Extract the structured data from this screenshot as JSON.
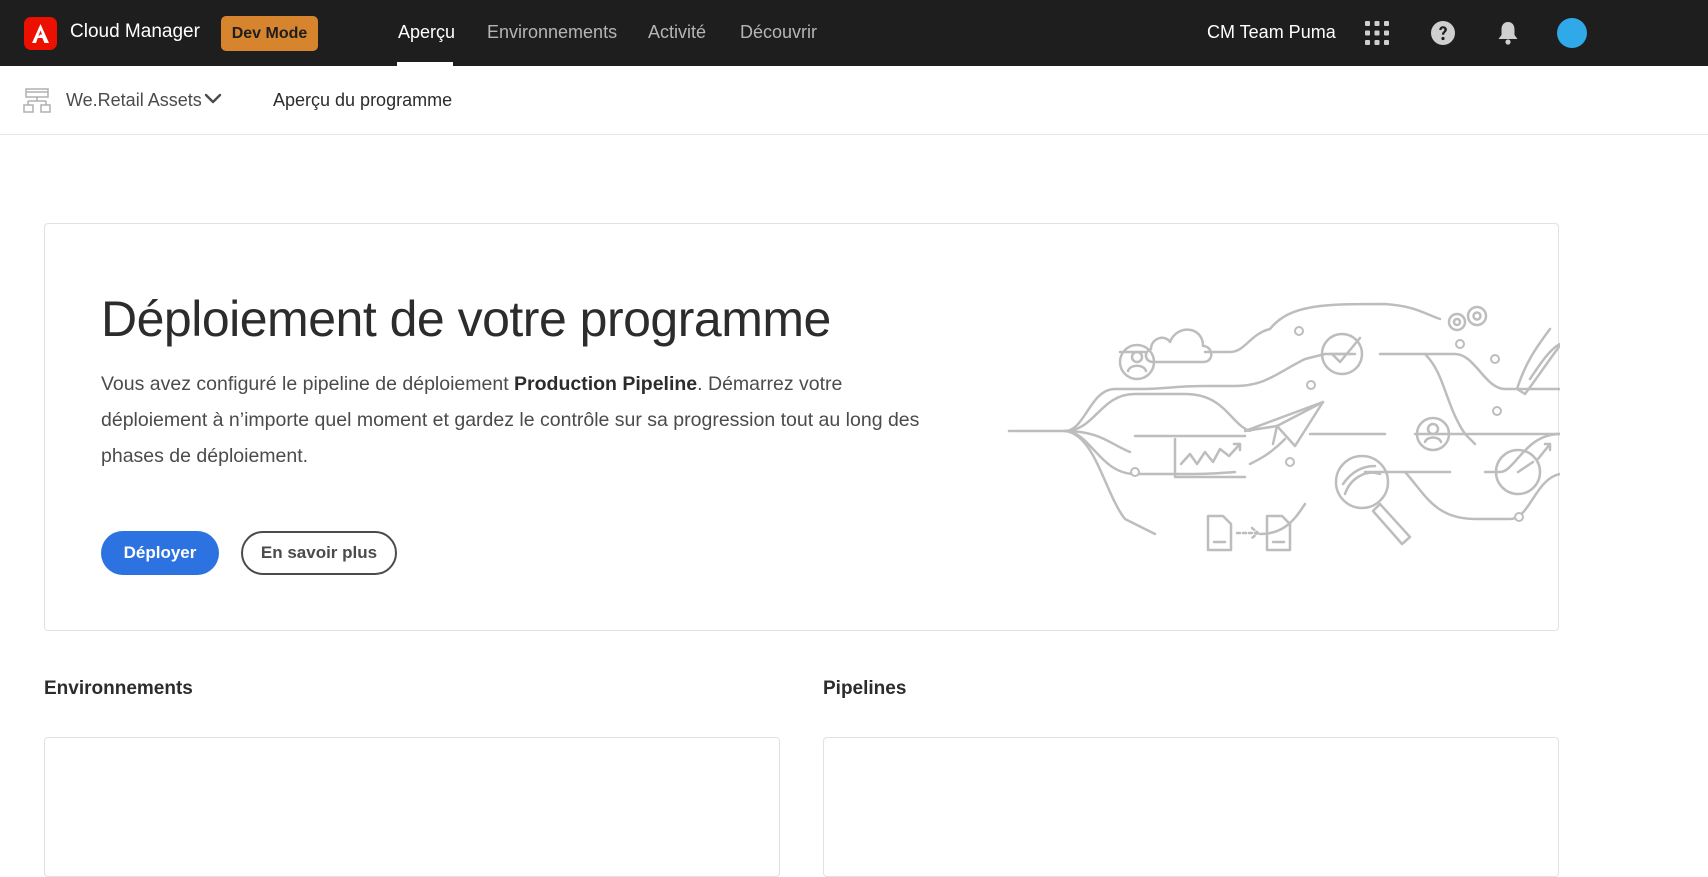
{
  "header": {
    "app_title": "Cloud Manager",
    "dev_mode_label": "Dev Mode",
    "tabs": [
      {
        "label": "Aperçu",
        "active": true
      },
      {
        "label": "Environnements",
        "active": false
      },
      {
        "label": "Activité",
        "active": false
      },
      {
        "label": "Découvrir",
        "active": false
      }
    ],
    "team_name": "CM Team Puma",
    "icons": [
      "apps-grid-icon",
      "help-icon",
      "notifications-bell-icon",
      "user-avatar"
    ]
  },
  "subheader": {
    "program_name": "We.Retail Assets",
    "page_title": "Aperçu du programme"
  },
  "hero": {
    "title": "Déploiement de votre programme",
    "text_before": "Vous avez configuré le pipeline de déploiement ",
    "pipeline_name": "Production Pipeline",
    "text_after": ". Démarrez votre déploiement à n’importe quel moment et gardez le contrôle sur sa progression tout au long des phases de déploiement.",
    "deploy_button": "Déployer",
    "learn_more_button": "En savoir plus"
  },
  "sections": {
    "environments_title": "Environnements",
    "pipelines_title": "Pipelines"
  },
  "colors": {
    "topbar": "#1e1e1e",
    "brand_red": "#eb1000",
    "dev_mode": "#d6852e",
    "primary_button": "#2c72e0"
  }
}
